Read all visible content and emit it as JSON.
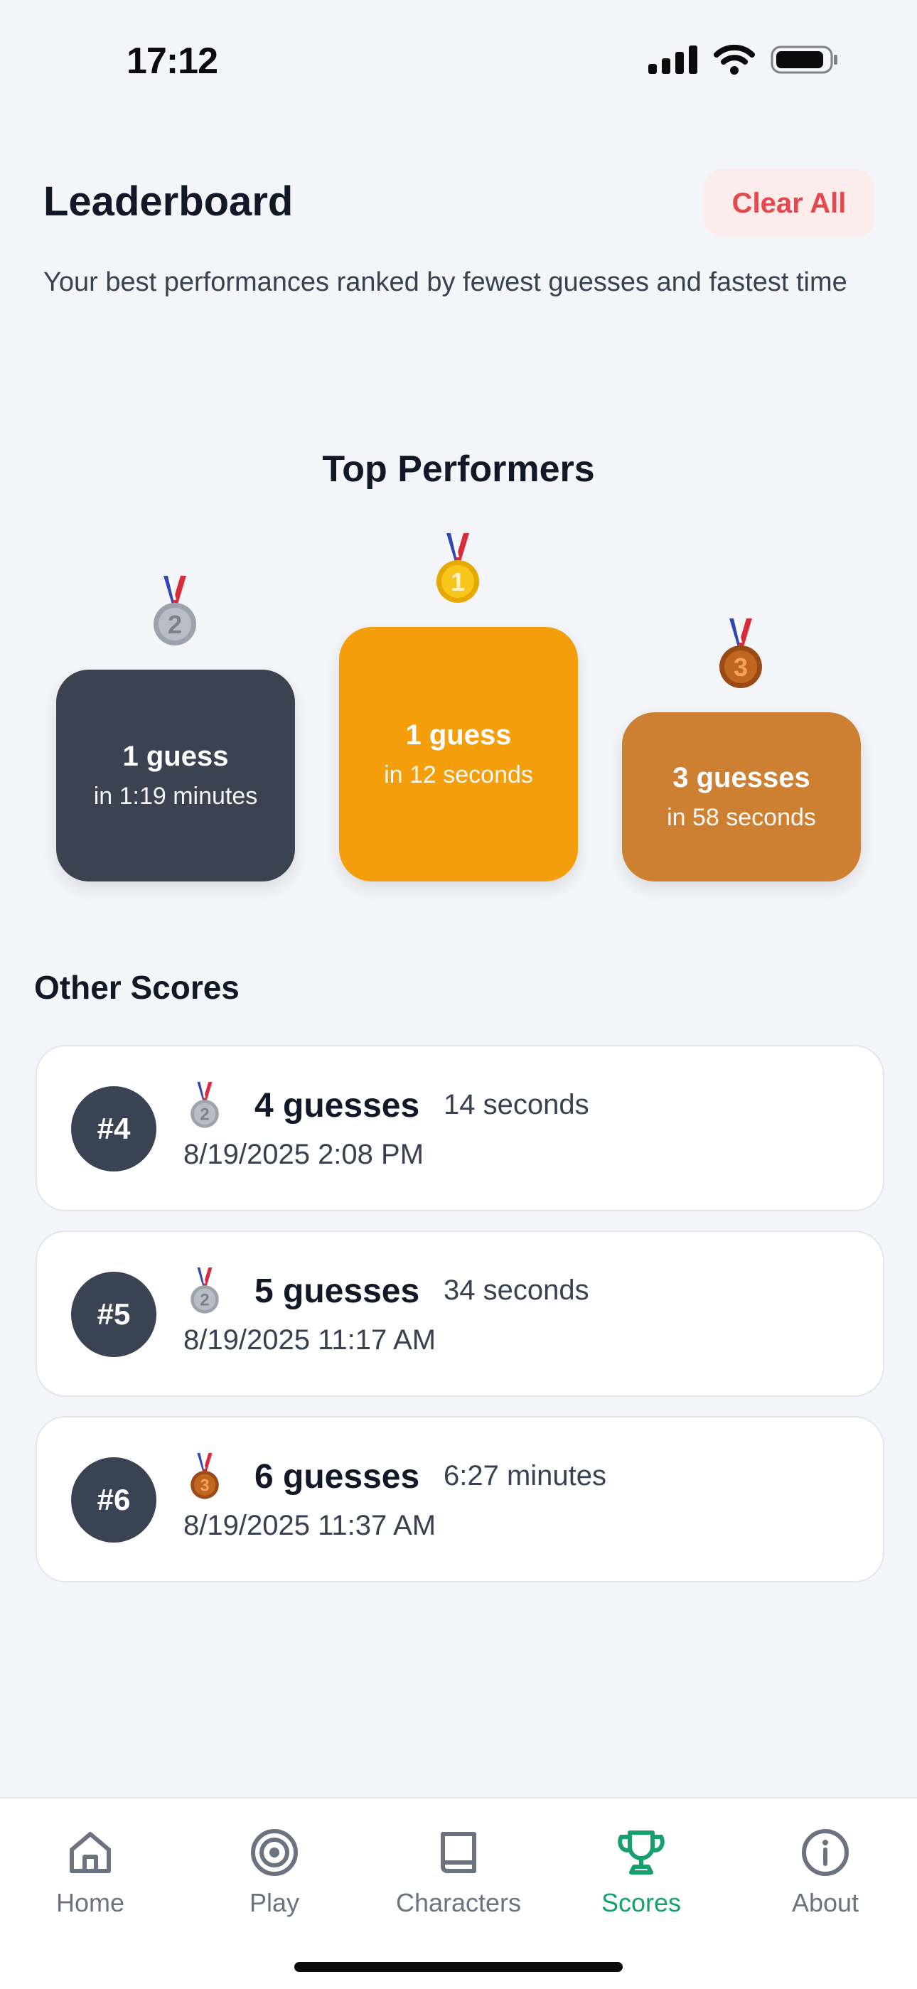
{
  "status_bar": {
    "time": "17:12"
  },
  "header": {
    "title": "Leaderboard",
    "clear_label": "Clear All",
    "subtitle": "Your best performances ranked by fewest guesses and fastest time"
  },
  "top_section": {
    "title": "Top Performers",
    "podium": [
      {
        "place": "2",
        "guesses": "1 guess",
        "time": "in 1:19 minutes",
        "color": "#3b4252",
        "medal": "silver"
      },
      {
        "place": "1",
        "guesses": "1 guess",
        "time": "in 12 seconds",
        "color": "#f59e0b",
        "medal": "gold"
      },
      {
        "place": "3",
        "guesses": "3 guesses",
        "time": "in 58 seconds",
        "color": "#cd7f32",
        "medal": "bronze"
      }
    ]
  },
  "other_section": {
    "title": "Other Scores",
    "rows": [
      {
        "rank": "#4",
        "medal": "silver",
        "guesses": "4 guesses",
        "time": "14 seconds",
        "date": "8/19/2025 2:08 PM"
      },
      {
        "rank": "#5",
        "medal": "silver",
        "guesses": "5 guesses",
        "time": "34 seconds",
        "date": "8/19/2025 11:17 AM"
      },
      {
        "rank": "#6",
        "medal": "bronze",
        "guesses": "6 guesses",
        "time": "6:27 minutes",
        "date": "8/19/2025 11:37 AM"
      }
    ]
  },
  "tabbar": {
    "active": "Scores",
    "active_color": "#16a06c",
    "items": [
      {
        "label": "Home",
        "icon": "home-icon"
      },
      {
        "label": "Play",
        "icon": "target-icon"
      },
      {
        "label": "Characters",
        "icon": "book-icon"
      },
      {
        "label": "Scores",
        "icon": "trophy-icon"
      },
      {
        "label": "About",
        "icon": "info-icon"
      }
    ]
  }
}
